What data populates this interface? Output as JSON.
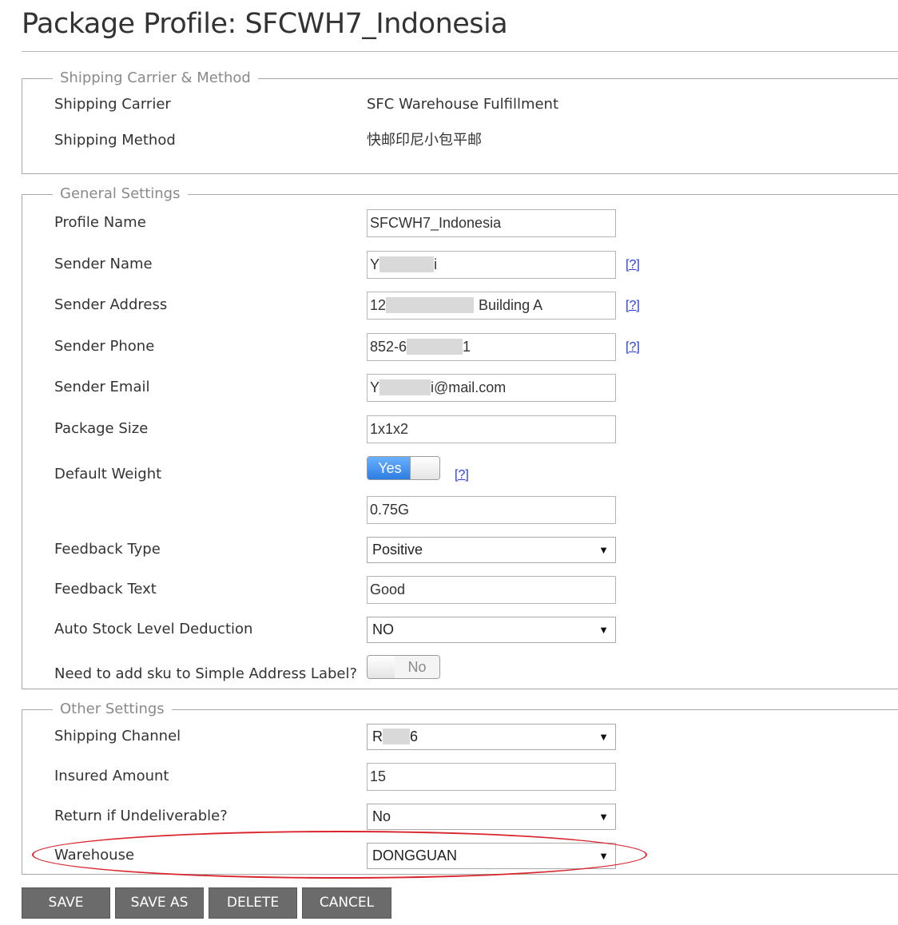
{
  "page": {
    "title": "Package Profile: SFCWH7_Indonesia"
  },
  "shipping_section": {
    "legend": "Shipping Carrier & Method",
    "carrier_label": "Shipping Carrier",
    "carrier_value": "SFC Warehouse Fulfillment",
    "method_label": "Shipping Method",
    "method_value": "快邮印尼小包平邮"
  },
  "general_section": {
    "legend": "General Settings",
    "profile_name": {
      "label": "Profile Name",
      "value": "SFCWH7_Indonesia"
    },
    "sender_name": {
      "label": "Sender Name",
      "value_start": "Y",
      "value_end": "i",
      "help": "[?]"
    },
    "sender_address": {
      "label": "Sender Address",
      "value_start": "12",
      "value_end": "Building A",
      "help": "[?]"
    },
    "sender_phone": {
      "label": "Sender Phone",
      "value_start": "852-6",
      "value_end": "1",
      "help": "[?]"
    },
    "sender_email": {
      "label": "Sender Email",
      "value_start": "Y",
      "value_end": "i@mail.com"
    },
    "package_size": {
      "label": "Package Size",
      "value": "1x1x2"
    },
    "default_weight": {
      "label": "Default Weight",
      "toggle": "Yes",
      "help": "[?]",
      "value": "0.75G"
    },
    "feedback_type": {
      "label": "Feedback Type",
      "selected": "Positive"
    },
    "feedback_text": {
      "label": "Feedback Text",
      "value": "Good"
    },
    "auto_stock": {
      "label": "Auto Stock Level Deduction",
      "selected": "NO"
    },
    "sku_label": {
      "label": "Need to add sku to Simple Address Label?",
      "toggle": "No"
    }
  },
  "other_section": {
    "legend": "Other Settings",
    "shipping_channel": {
      "label": "Shipping Channel",
      "value_start": "R",
      "value_end": "6"
    },
    "insured_amount": {
      "label": "Insured Amount",
      "value": "15"
    },
    "return_undeliverable": {
      "label": "Return if Undeliverable?",
      "selected": "No"
    },
    "warehouse": {
      "label": "Warehouse",
      "selected": "DONGGUAN"
    }
  },
  "actions": {
    "save": "SAVE",
    "save_as": "SAVE AS",
    "delete": "DELETE",
    "cancel": "CANCEL"
  },
  "colors": {
    "highlight": "#d9262e",
    "help_link": "#2a3bd6",
    "toggle_on": "#2e7de2",
    "button_bg": "#6b6b6b"
  }
}
